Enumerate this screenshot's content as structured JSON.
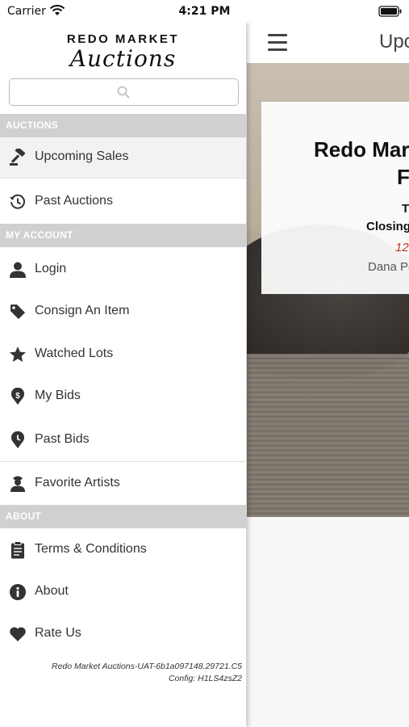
{
  "status_bar": {
    "carrier": "Carrier",
    "time": "4:21 PM"
  },
  "drawer": {
    "logo_top": "REDO MARKET",
    "logo_script": "Auctions",
    "search": {
      "placeholder": ""
    },
    "sections": {
      "auctions": "AUCTIONS",
      "my_account": "MY ACCOUNT",
      "about": "ABOUT"
    },
    "items": {
      "upcoming_sales": "Upcoming Sales",
      "past_auctions": "Past Auctions",
      "login": "Login",
      "consign": "Consign An Item",
      "watched_lots": "Watched Lots",
      "my_bids": "My Bids",
      "past_bids": "Past Bids",
      "favorite_artists": "Favorite Artists",
      "terms": "Terms & Conditions",
      "about": "About",
      "rate_us": "Rate Us"
    },
    "footer": {
      "build": "Redo Market Auctions-UAT-6b1a097148.29721.C5",
      "config": "Config: H1LS4zsZ2"
    }
  },
  "main": {
    "title": "Upo",
    "card": {
      "title": "Redo Mar",
      "title2": "F",
      "line_t": "T",
      "closing": "Closing",
      "date": "12",
      "name": "Dana Pe"
    }
  },
  "colors": {
    "accent_date": "#c0392b",
    "section_bg": "#d0d0d0"
  },
  "icons": [
    "wifi-icon",
    "battery-icon",
    "search-icon",
    "gavel-icon",
    "history-icon",
    "user-icon",
    "tag-icon",
    "star-icon",
    "dollar-pin-icon",
    "clock-pin-icon",
    "artist-icon",
    "clipboard-icon",
    "info-icon",
    "heart-icon",
    "hamburger-icon"
  ]
}
